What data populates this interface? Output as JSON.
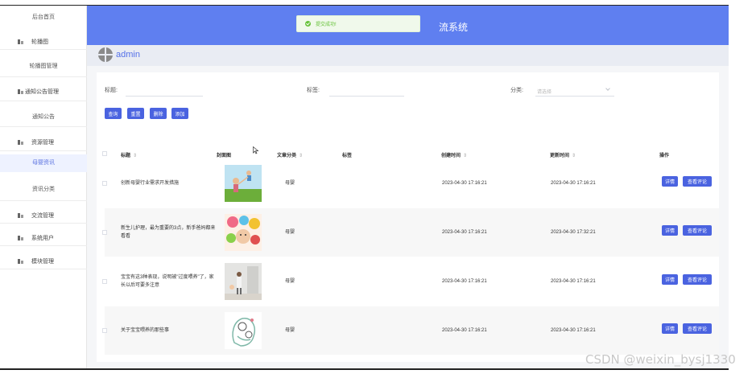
{
  "header": {
    "title": "流系统",
    "toast": "提交成功!"
  },
  "user": {
    "name": "admin"
  },
  "sidebar": {
    "top": "后台首页",
    "items": [
      {
        "label": "轮播图",
        "sub": "轮播图管理"
      },
      {
        "label": "通知公告管理",
        "sub": "通知公告"
      },
      {
        "label": "资源管理",
        "subs": [
          "母婴资讯",
          "资讯分类"
        ]
      },
      {
        "label": "交流管理"
      },
      {
        "label": "系统用户"
      },
      {
        "label": "模块管理"
      }
    ]
  },
  "filters": {
    "title_label": "标题:",
    "tag_label": "标签:",
    "category_label": "分类:",
    "category_placeholder": "请选择"
  },
  "buttons": {
    "query": "查询",
    "reset": "重置",
    "delete": "删除",
    "add": "添加"
  },
  "table": {
    "headers": [
      "标题",
      "封面图",
      "文章分类",
      "标签",
      "创建时间",
      "更新时间",
      "操作"
    ],
    "rows": [
      {
        "title": "创新母婴行业需求开发措施",
        "category": "母婴",
        "created": "2023-04-30 17:16:21",
        "updated": "2023-04-30 17:16:21"
      },
      {
        "title": "新生儿护理，最为重要的3点，新手爸妈都来看看",
        "category": "母婴",
        "created": "2023-04-30 17:16:21",
        "updated": "2023-04-30 17:32:21"
      },
      {
        "title": "宝宝有这3种表现，说明被\"过度喂养\"了，家长以后可要多注意",
        "category": "母婴",
        "created": "2023-04-30 17:16:21",
        "updated": "2023-04-30 17:16:21"
      },
      {
        "title": "关于宝宝喂养的那些事",
        "category": "母婴",
        "created": "2023-04-30 17:16:21",
        "updated": "2023-04-30 17:16:21"
      }
    ],
    "detail_label": "详情",
    "comment_label": "查看评论"
  },
  "watermark": "CSDN @weixin_bysj1330"
}
